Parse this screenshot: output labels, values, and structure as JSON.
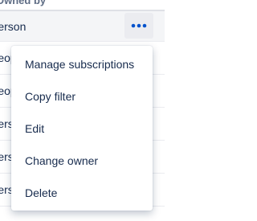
{
  "table": {
    "header_label": "Owned by",
    "rows": [
      {
        "owner": "Person"
      },
      {
        "owner": "People"
      },
      {
        "owner": "People"
      },
      {
        "owner": "Person"
      },
      {
        "owner": "Person"
      },
      {
        "owner": "Person"
      }
    ]
  },
  "actions_button": {
    "icon": "more-horizontal-icon",
    "color": "#0052cc"
  },
  "menu": {
    "items": [
      {
        "label": "Manage subscriptions"
      },
      {
        "label": "Copy filter"
      },
      {
        "label": "Edit"
      },
      {
        "label": "Change owner"
      },
      {
        "label": "Delete"
      }
    ]
  }
}
